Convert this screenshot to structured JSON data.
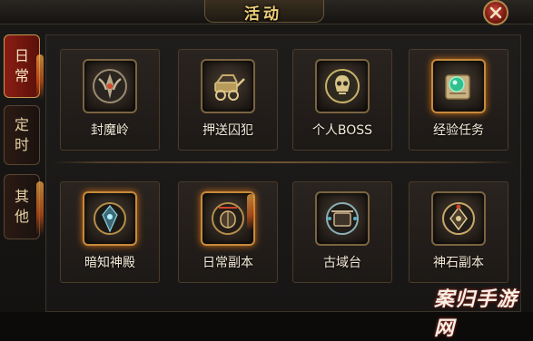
{
  "window": {
    "title": "活动"
  },
  "side_tabs": [
    {
      "label": "日常",
      "active": true
    },
    {
      "label": "定时",
      "active": false
    },
    {
      "label": "其他",
      "active": false
    }
  ],
  "activities": [
    {
      "label": "封魔岭",
      "icon": "demon-crest-icon"
    },
    {
      "label": "押送囚犯",
      "icon": "cart-icon"
    },
    {
      "label": "个人BOSS",
      "icon": "skull-emblem-icon"
    },
    {
      "label": "经验任务",
      "icon": "scroll-orb-icon"
    },
    {
      "label": "暗知神殿",
      "icon": "dark-temple-icon"
    },
    {
      "label": "日常副本",
      "icon": "gate-emblem-icon"
    },
    {
      "label": "古域台",
      "icon": "ancient-altar-icon"
    },
    {
      "label": "神石副本",
      "icon": "sacred-stone-icon"
    }
  ],
  "watermark": {
    "text": "案归手游网"
  },
  "colors": {
    "title_gold": "#f0cf7a",
    "active_tab": "#8a1e14",
    "frame_border": "#7a6440"
  }
}
